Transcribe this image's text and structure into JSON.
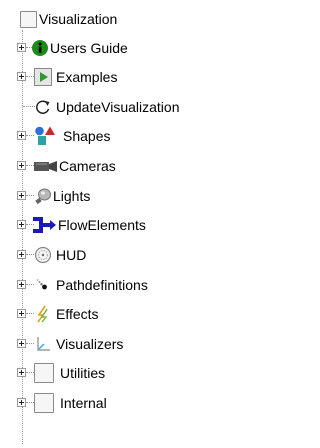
{
  "tree": {
    "root": {
      "label": "Visualization",
      "icon": "checkbox"
    },
    "items": [
      {
        "label": "Users Guide",
        "icon": "info-icon",
        "expandable": true
      },
      {
        "label": "Examples",
        "icon": "play-icon",
        "expandable": true
      },
      {
        "label": "UpdateVisualization",
        "icon": "refresh-icon",
        "expandable": false
      },
      {
        "label": "Shapes",
        "icon": "shapes-icon",
        "expandable": true
      },
      {
        "label": "Cameras",
        "icon": "camera-icon",
        "expandable": true
      },
      {
        "label": "Lights",
        "icon": "light-icon",
        "expandable": true
      },
      {
        "label": "FlowElements",
        "icon": "flow-elements-icon",
        "expandable": true
      },
      {
        "label": "HUD",
        "icon": "hud-icon",
        "expandable": true
      },
      {
        "label": "Pathdefinitions",
        "icon": "path-icon",
        "expandable": true
      },
      {
        "label": "Effects",
        "icon": "effects-icon",
        "expandable": true
      },
      {
        "label": "Visualizers",
        "icon": "visualizers-icon",
        "expandable": true
      },
      {
        "label": "Utilities",
        "icon": "checkbox",
        "expandable": true
      },
      {
        "label": "Internal",
        "icon": "checkbox",
        "expandable": true
      }
    ]
  }
}
